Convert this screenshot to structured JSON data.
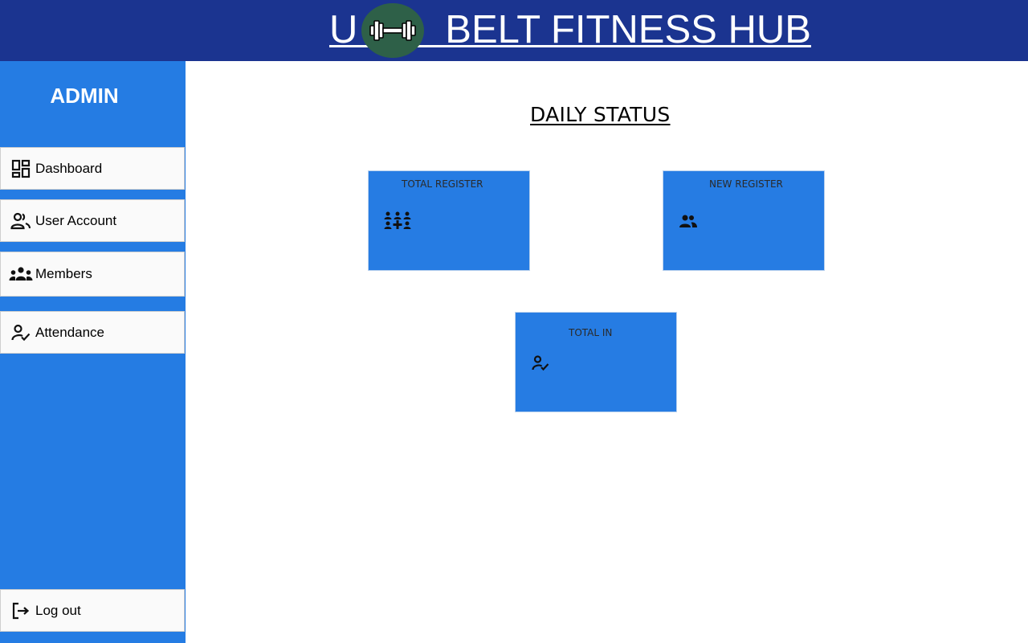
{
  "header": {
    "title": "U        BELT FITNESS HUB",
    "logo_icon": "dumbbell-icon",
    "background_color": "#1b3490",
    "logo_color": "#2e6048"
  },
  "sidebar": {
    "heading": "ADMIN",
    "background_color": "#257ce3",
    "items": [
      {
        "label": "Dashboard",
        "icon": "dashboard-icon"
      },
      {
        "label": "User Account",
        "icon": "users-icon"
      },
      {
        "label": "Members",
        "icon": "group-icon"
      },
      {
        "label": "Attendance",
        "icon": "person-check-icon"
      }
    ],
    "logout": {
      "label": "Log out",
      "icon": "logout-icon"
    }
  },
  "main": {
    "heading": "DAILY STATUS",
    "cards": [
      {
        "title": "TOTAL REGISTER",
        "icon": "group-add-icon"
      },
      {
        "title": "NEW REGISTER",
        "icon": "users-icon"
      },
      {
        "title": "TOTAL IN",
        "icon": "person-check-icon"
      }
    ],
    "card_color": "#267ce3"
  }
}
